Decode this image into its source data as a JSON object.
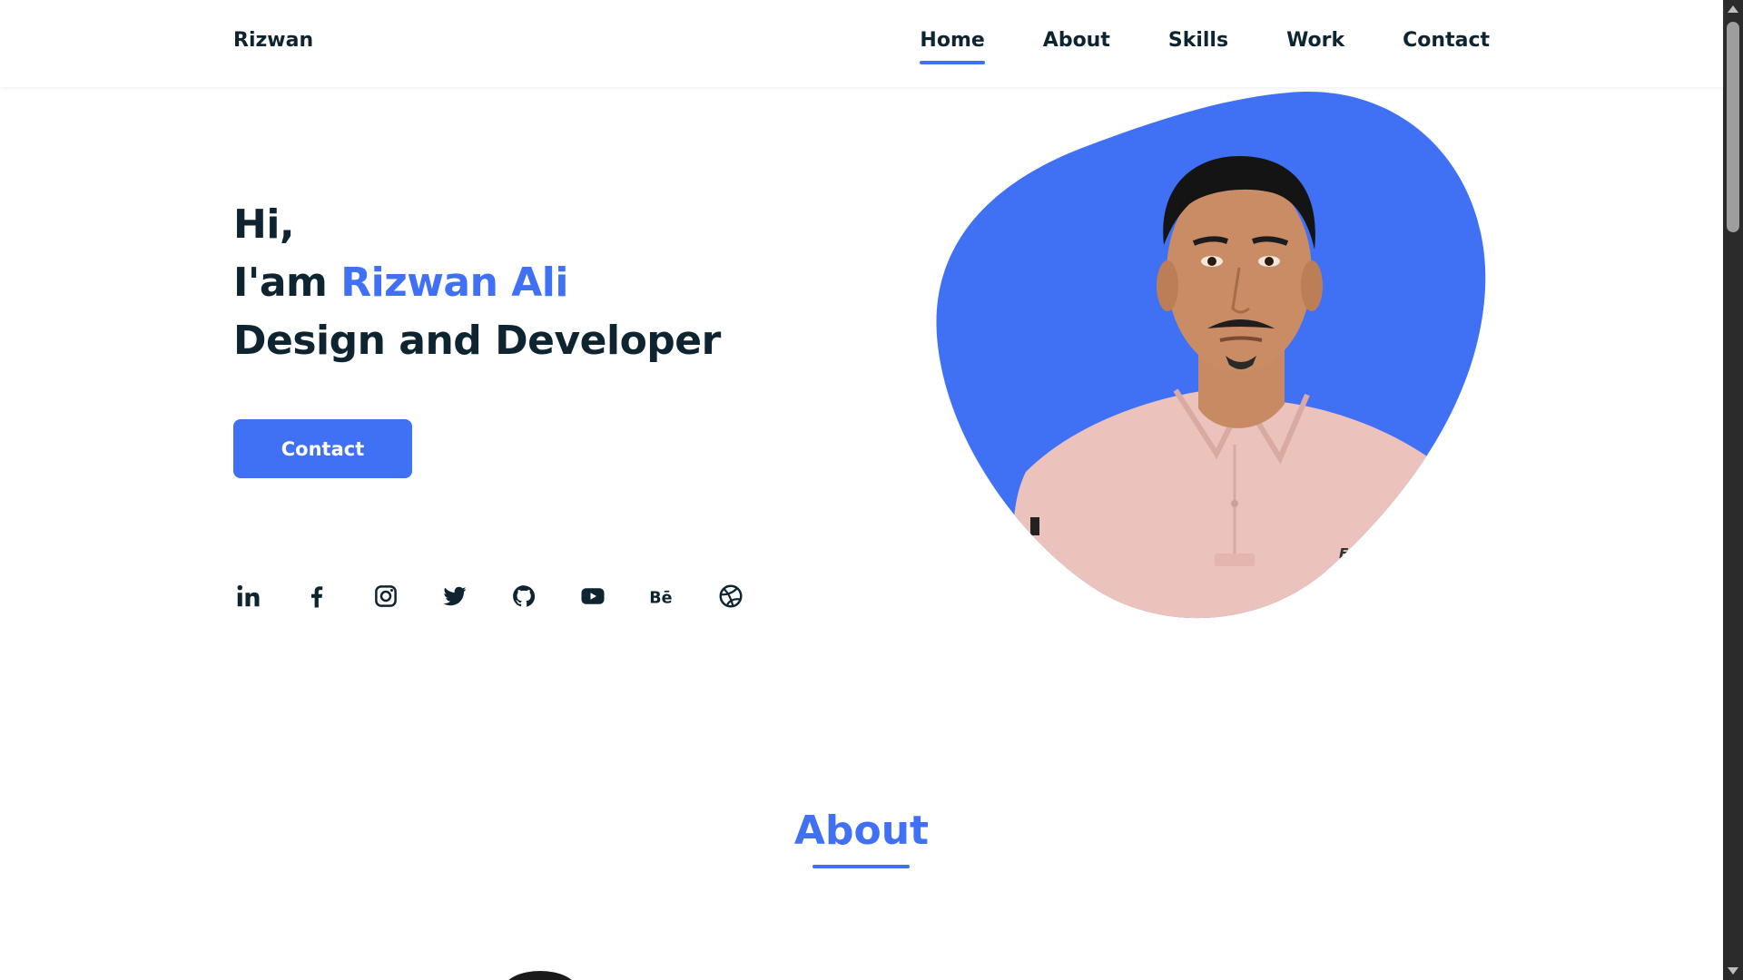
{
  "header": {
    "logo": "Rizwan",
    "nav": [
      {
        "label": "Home",
        "active": true
      },
      {
        "label": "About",
        "active": false
      },
      {
        "label": "Skills",
        "active": false
      },
      {
        "label": "Work",
        "active": false
      },
      {
        "label": "Contact",
        "active": false
      }
    ]
  },
  "hero": {
    "greeting": "Hi,",
    "intro_prefix": "I'am ",
    "name": "Rizwan Ali",
    "role": "Design and Developer",
    "button_label": "Contact"
  },
  "social": [
    "linkedin-icon",
    "facebook-icon",
    "instagram-icon",
    "twitter-icon",
    "github-icon",
    "youtube-icon",
    "behance-icon",
    "dribbble-icon"
  ],
  "about": {
    "title": "About"
  },
  "colors": {
    "accent": "#4070f4",
    "text": "#0e2431",
    "shirt": "#ecc2bc"
  }
}
